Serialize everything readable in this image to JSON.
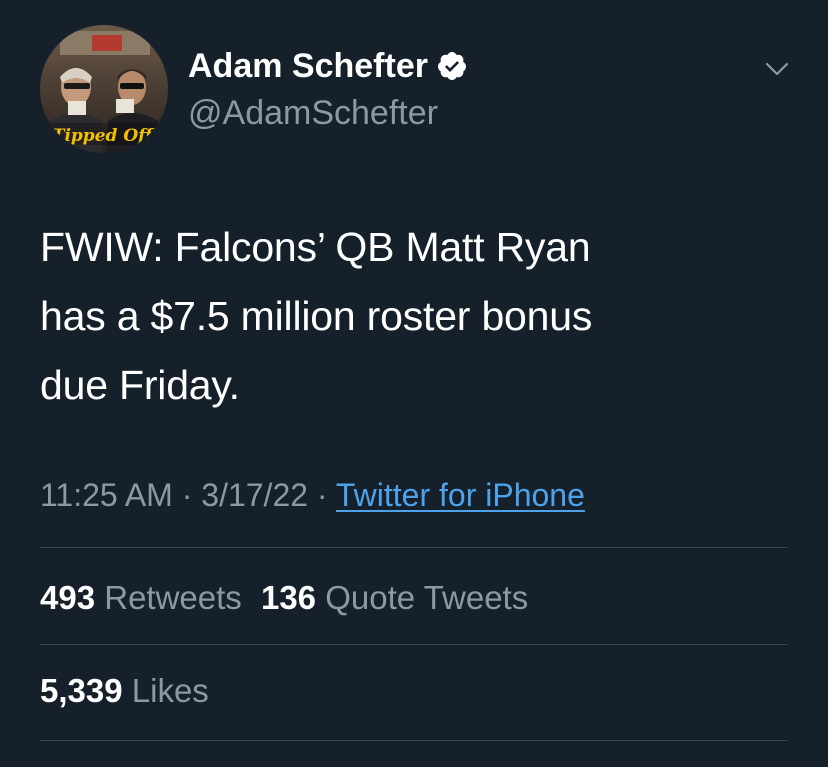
{
  "user": {
    "display_name": "Adam Schefter",
    "handle": "@AdamSchefter",
    "verified_icon": "verified-badge-icon",
    "avatar_caption": "Tipped Off"
  },
  "menu_icon": "chevron-down-icon",
  "tweet": {
    "text_lines": [
      "FWIW: Falcons’ QB Matt Ryan",
      "has a $7.5 million roster bonus",
      "due Friday."
    ],
    "time": "11:25 AM",
    "separator": "·",
    "date": "3/17/22",
    "source": "Twitter for iPhone"
  },
  "stats": {
    "retweets_count": "493",
    "retweets_label": "Retweets",
    "quotes_count": "136",
    "quotes_label": "Quote Tweets",
    "likes_count": "5,339",
    "likes_label": "Likes"
  },
  "colors": {
    "background": "#15202b",
    "secondary_text": "#8b98a5",
    "link": "#4ca3ec",
    "divider": "#38444d"
  }
}
